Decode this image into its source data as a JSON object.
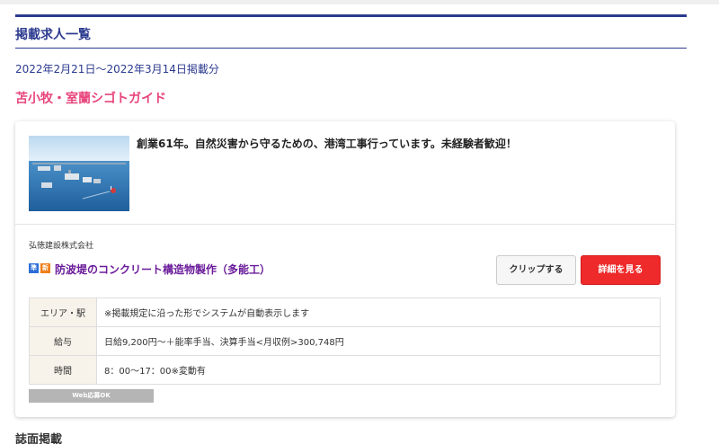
{
  "page": {
    "list_title": "掲載求人一覧",
    "period": "2022年2月21日～2022年3月14日掲載分",
    "media_name": "苫小牧・室蘭シゴトガイド",
    "section_title": "誌面掲載"
  },
  "job": {
    "catch_copy": "創業61年。自然災害から守るための、港湾工事行っています。未経験者歓迎！",
    "company": "弘徳建設株式会社",
    "badges": [
      "準",
      "新"
    ],
    "title": "防波堤のコンクリート構造物製作（多能工）",
    "clip_label": "クリップする",
    "detail_label": "詳細を見る",
    "info": [
      {
        "label": "エリア・駅",
        "value": "※掲載規定に沿った形でシステムが自動表示します"
      },
      {
        "label": "給与",
        "value": "日給9,200円～＋能率手当、決算手当<月収例>300,748円"
      },
      {
        "label": "時間",
        "value": "8：00～17：00※変動有"
      }
    ],
    "web_badge": "Web応募OK",
    "image_icon": "harbor-photo"
  },
  "colors": {
    "brand_navy": "#2b3a8f",
    "media_pink": "#e8457c",
    "job_title_purple": "#6a1b9a",
    "detail_red": "#ee2a2a"
  }
}
